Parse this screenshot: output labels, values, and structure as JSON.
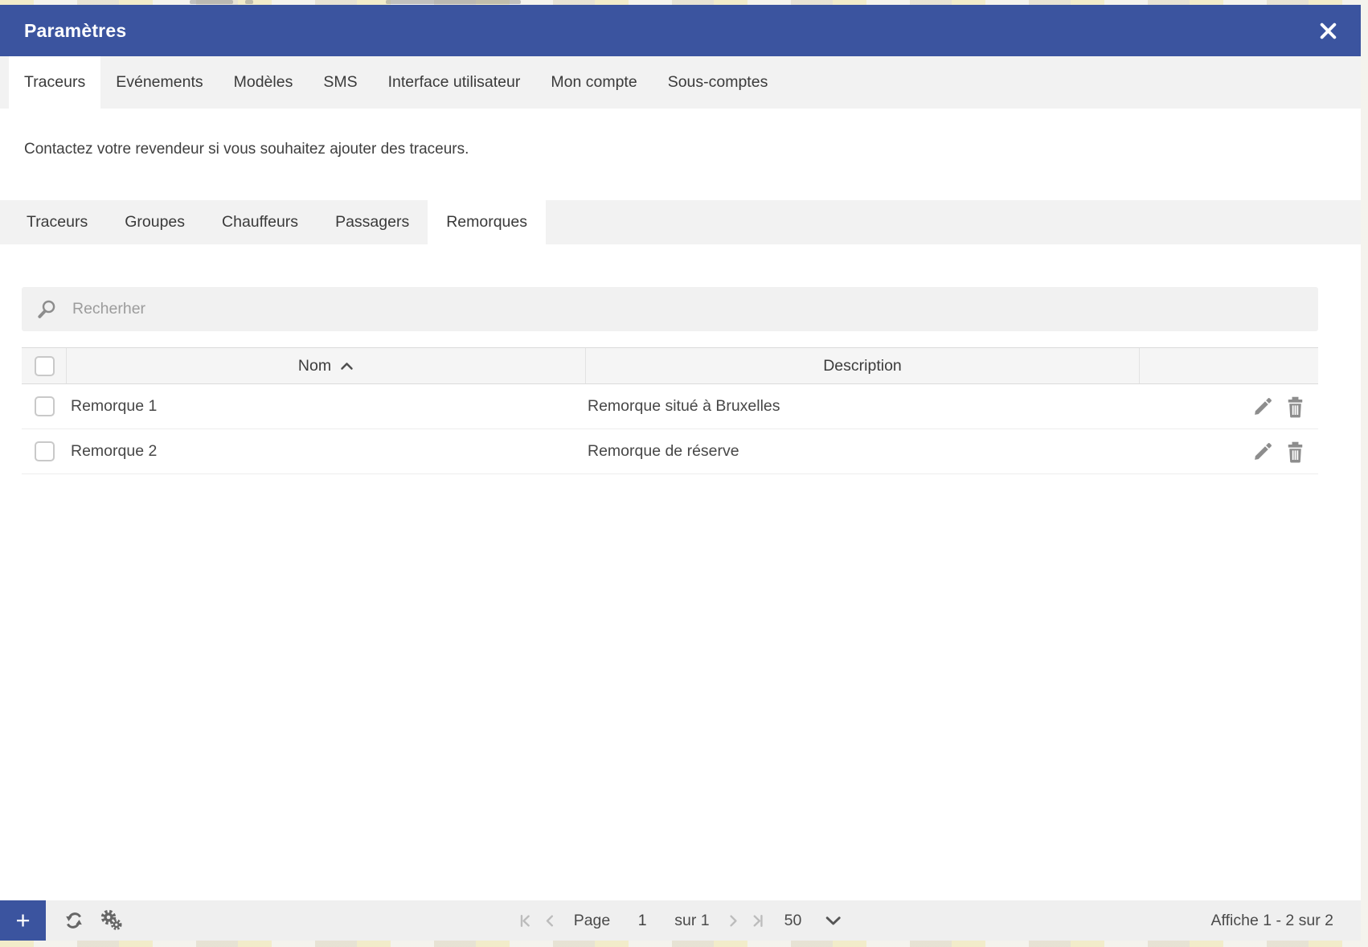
{
  "window": {
    "title": "Paramètres"
  },
  "main_tabs": [
    {
      "label": "Traceurs",
      "active": true
    },
    {
      "label": "Evénements",
      "active": false
    },
    {
      "label": "Modèles",
      "active": false
    },
    {
      "label": "SMS",
      "active": false
    },
    {
      "label": "Interface utilisateur",
      "active": false
    },
    {
      "label": "Mon compte",
      "active": false
    },
    {
      "label": "Sous-comptes",
      "active": false
    }
  ],
  "notice": "Contactez votre revendeur si vous souhaitez ajouter des traceurs.",
  "sub_tabs": [
    {
      "label": "Traceurs",
      "active": false
    },
    {
      "label": "Groupes",
      "active": false
    },
    {
      "label": "Chauffeurs",
      "active": false
    },
    {
      "label": "Passagers",
      "active": false
    },
    {
      "label": "Remorques",
      "active": true
    }
  ],
  "search": {
    "placeholder": "Recherher"
  },
  "table": {
    "columns": {
      "name": "Nom",
      "description": "Description"
    },
    "rows": [
      {
        "name": "Remorque 1",
        "description": "Remorque situé à Bruxelles"
      },
      {
        "name": "Remorque 2",
        "description": "Remorque de réserve"
      }
    ]
  },
  "footer": {
    "add_label": "+",
    "page_label": "Page",
    "page_value": "1",
    "of_label": "sur 1",
    "page_size": "50",
    "summary": "Affiche 1 - 2 sur 2"
  },
  "icons": {
    "close": "x-cross",
    "search": "magnifier",
    "sort_ascending": "chevron-up",
    "edit": "pencil",
    "delete": "trash-can",
    "refresh": "circular-arrows",
    "grid_settings": "gears",
    "first_page": "chevron-bar-left",
    "prev_page": "chevron-left",
    "next_page": "chevron-right",
    "last_page": "chevron-bar-right",
    "page_size_caret": "chevron-down"
  },
  "colors": {
    "header_blue": "#3b549f",
    "tab_bar_gray": "#f2f2f2",
    "active_tab_white": "#ffffff",
    "table_header_gray": "#f5f5f5",
    "footer_gray": "#efefef",
    "icon_gray": "#8d8d8d",
    "map_beige": "#eae7db"
  }
}
